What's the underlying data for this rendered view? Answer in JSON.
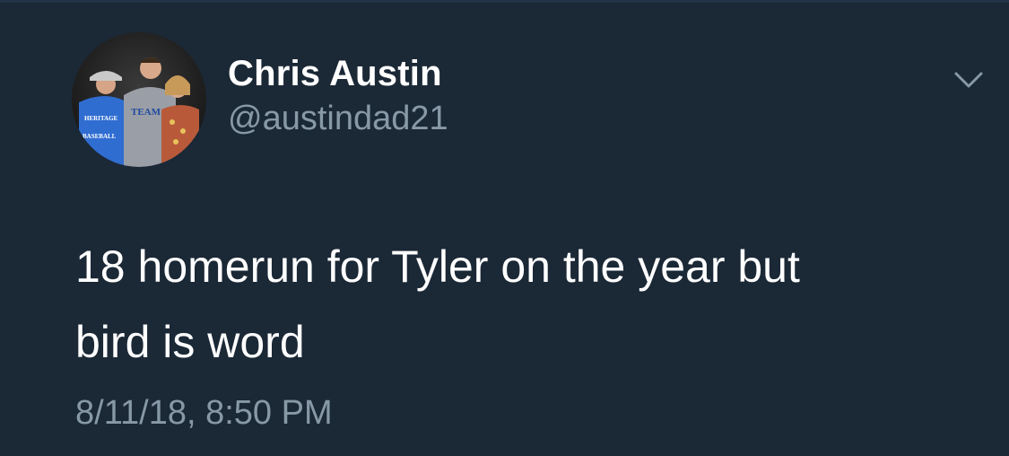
{
  "tweet": {
    "display_name": "Chris Austin",
    "handle": "@austindad21",
    "text_line1": "18 homerun for Tyler on the year but",
    "text_line2": "bird is word",
    "timestamp": "8/11/18, 8:50 PM"
  },
  "icons": {
    "caret": "chevron-down-icon",
    "avatar": "profile-photo"
  },
  "colors": {
    "background": "#1b2836",
    "primary_text": "#ffffff",
    "secondary_text": "#8899a6"
  }
}
